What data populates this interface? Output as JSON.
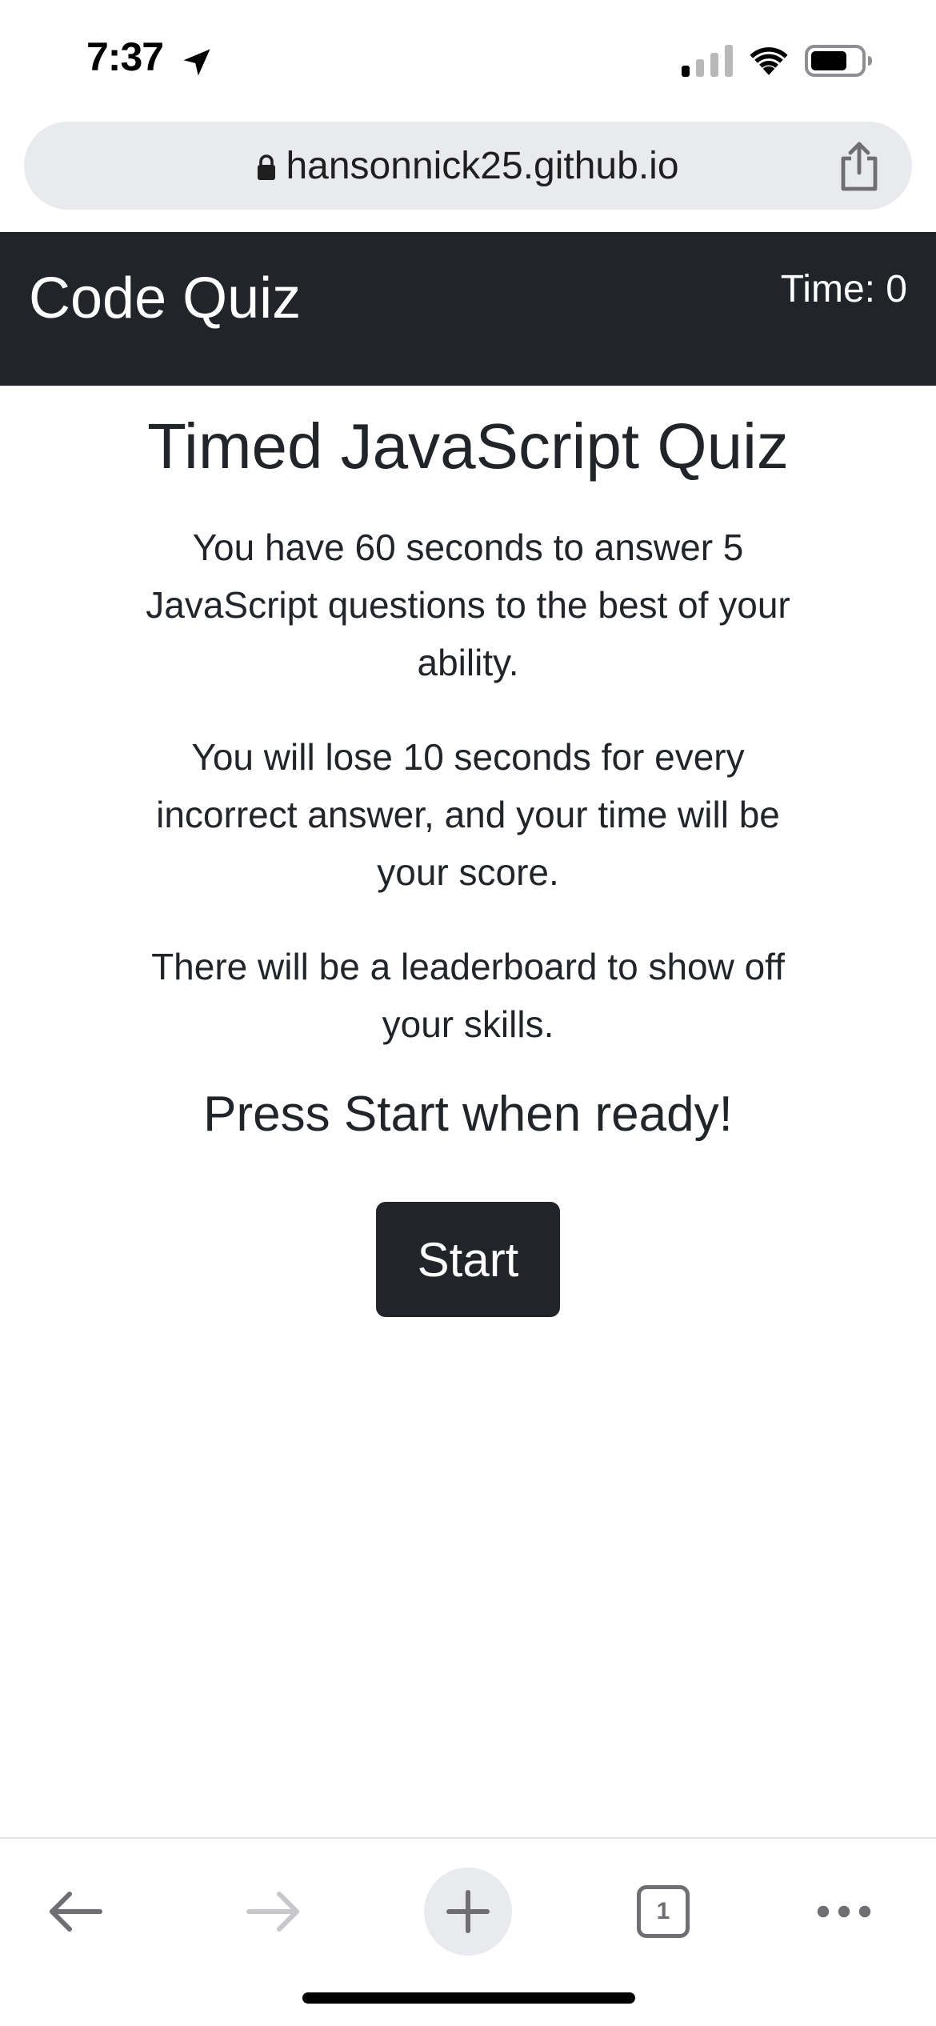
{
  "status_bar": {
    "time": "7:37",
    "icons": [
      "location-arrow-icon",
      "cellular-signal-icon",
      "wifi-icon",
      "battery-icon"
    ]
  },
  "browser": {
    "address": "hansonnick25.github.io",
    "lock_icon": "lock-icon",
    "share_icon": "share-icon",
    "tab_count": "1"
  },
  "navbar": {
    "brand": "Code Quiz",
    "timer": "Time: 0",
    "background": "#212529"
  },
  "main": {
    "title": "Timed JavaScript Quiz",
    "paragraphs": [
      "You have 60 seconds to answer 5 JavaScript questions to the best of your ability.",
      "You will lose 10 seconds for every incorrect answer, and your time will be your score.",
      "There will be a leaderboard to show off your skills."
    ],
    "ready_text": "Press Start when ready!",
    "start_label": "Start"
  },
  "toolbar": {
    "icons": [
      "back-arrow-icon",
      "forward-arrow-icon",
      "plus-icon",
      "tabs-icon",
      "more-icon"
    ]
  }
}
